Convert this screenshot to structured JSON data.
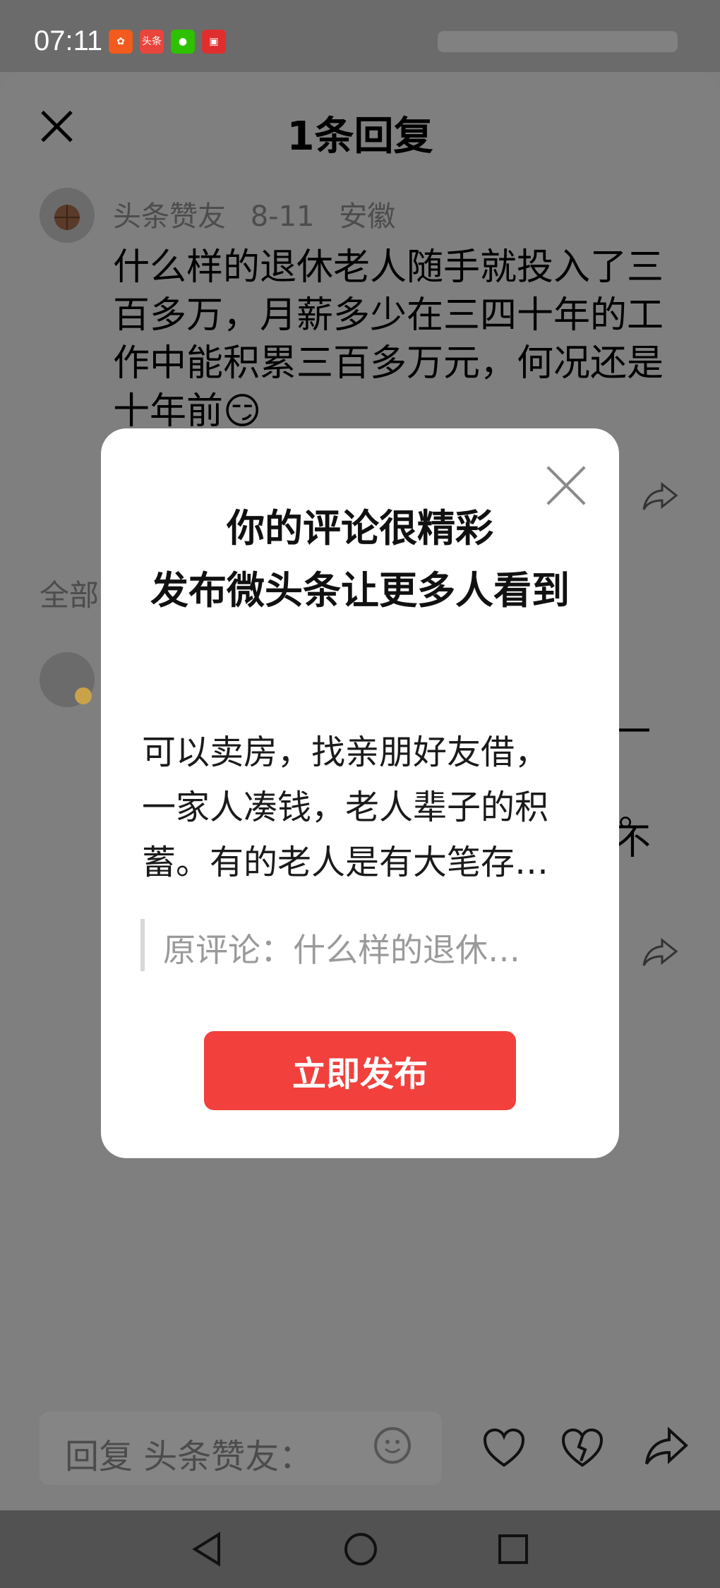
{
  "status_bar": {
    "time": "07:11",
    "app_icons": [
      {
        "name": "kuaishou-icon",
        "color": "#f25a1e",
        "label": ""
      },
      {
        "name": "toutiao-icon",
        "color": "#e8453c",
        "label": "头条"
      },
      {
        "name": "wechat-icon",
        "color": "#2dc100",
        "label": ""
      },
      {
        "name": "red-app-icon",
        "color": "#e02e2e",
        "label": ""
      }
    ]
  },
  "header": {
    "title": "1条回复"
  },
  "original_comment": {
    "author": "头条赞友",
    "date": "8-11",
    "location": "安徽",
    "text": "什么样的退休老人随手就投入了三百多万，月薪多少在三四十年的工作中能积累三百多万元，何况还是十年前😏"
  },
  "section": {
    "all_replies": "全部"
  },
  "reply_fragment": {
    "line1": "一",
    "line2": "。",
    "line3": "不"
  },
  "bottom": {
    "reply_placeholder": "回复 头条赞友："
  },
  "modal": {
    "title_line1": "你的评论很精彩",
    "title_line2": "发布微头条让更多人看到",
    "body": "可以卖房，找亲朋好友借，一家人凑钱，老人辈子的积蓄。有的老人是有大笔存…",
    "quote": "原评论：什么样的退休…",
    "publish_label": "立即发布"
  },
  "colors": {
    "accent": "#f2403c",
    "overlay": "#7f7f7f"
  }
}
